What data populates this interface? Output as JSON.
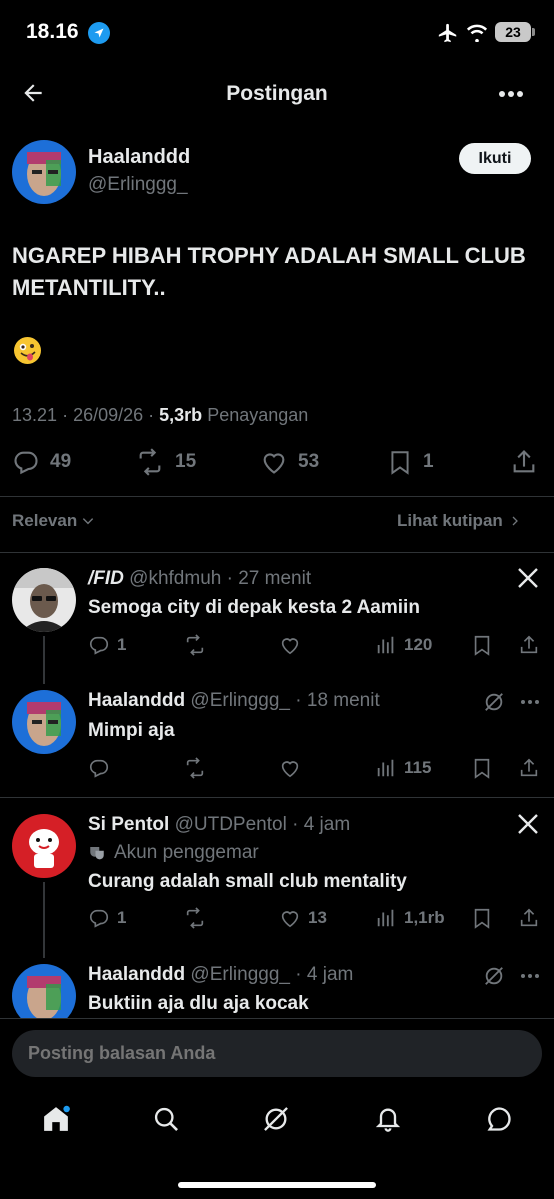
{
  "status_bar": {
    "time": "18.16",
    "battery": "23"
  },
  "header": {
    "title": "Postingan"
  },
  "post": {
    "author_name": "Haalanddd",
    "author_handle": "@Erlinggg_",
    "follow_label": "Ikuti",
    "text": "NGAREP HIBAH TROPHY ADALAH SMALL CLUB METANTILITY..",
    "time": "13.21",
    "date": "26/09/26",
    "views": "5,3rb",
    "views_label": "Penayangan",
    "replies": "49",
    "reposts": "15",
    "likes": "53",
    "bookmarks": "1"
  },
  "filter": {
    "sort_label": "Relevan",
    "quotes_label": "Lihat kutipan"
  },
  "replies": [
    {
      "name": "/FID",
      "handle": "@khfdmuh",
      "time": "27 menit",
      "text": "Semoga city di depak kesta 2 Aamiin",
      "replies": "1",
      "views": "120"
    },
    {
      "name": "Haalanddd",
      "handle": "@Erlinggg_",
      "time": "18 menit",
      "text": "Mimpi aja",
      "views": "115"
    },
    {
      "name": "Si Pentol",
      "handle": "@UTDPentol",
      "time": "4 jam",
      "badge": "Akun penggemar",
      "text": "Curang adalah small club mentality",
      "replies": "1",
      "likes": "13",
      "views": "1,1rb"
    },
    {
      "name": "Haalanddd",
      "handle": "@Erlinggg_",
      "time": "4 jam",
      "text": "Buktiin aja dlu aja kocak"
    }
  ],
  "reply_box": {
    "placeholder": "Posting balasan Anda"
  },
  "colors": {
    "background": "#000000",
    "muted": "#71767b",
    "text": "#e7e9ea",
    "accent": "#1d9bf0"
  }
}
